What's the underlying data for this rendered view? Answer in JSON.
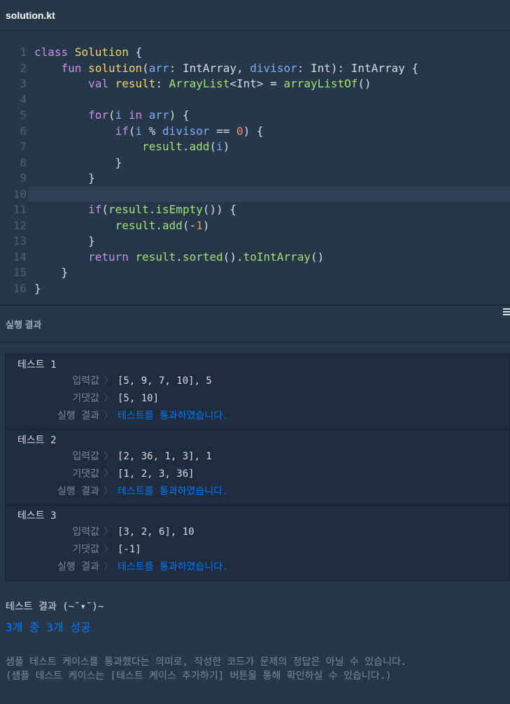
{
  "tab": {
    "title": "solution.kt"
  },
  "editor": {
    "active_line": 10,
    "line_numbers": [
      "1",
      "2",
      "3",
      "4",
      "5",
      "6",
      "7",
      "8",
      "9",
      "10",
      "11",
      "12",
      "13",
      "14",
      "15",
      "16"
    ]
  },
  "results": {
    "title": "실행 결과",
    "labels": {
      "input": "입력값",
      "expected": "기댓값",
      "result": "실행 결과",
      "sep": "〉"
    },
    "tests": [
      {
        "name": "테스트 1",
        "input": "[5, 9, 7, 10], 5",
        "expected": "[5, 10]",
        "result": "테스트를 통과하였습니다."
      },
      {
        "name": "테스트 2",
        "input": "[2, 36, 1, 3], 1",
        "expected": "[1, 2, 3, 36]",
        "result": "테스트를 통과하였습니다."
      },
      {
        "name": "테스트 3",
        "input": "[3, 2, 6], 10",
        "expected": "[-1]",
        "result": "테스트를 통과하였습니다."
      }
    ]
  },
  "summary": {
    "title": "테스트 결과 (~˘▾˘)~",
    "result": "3개 중 3개 성공",
    "note_line1": "샘플 테스트 케이스를 통과했다는 의미로, 작성한 코드가 문제의 정답은 아닐 수 있습니다.",
    "note_line2": "(샘플 테스트 케이스는 [테스트 케이스 추가하기] 버튼을 통해 확인하실 수 있습니다.)"
  },
  "colors": {
    "background": "#263747",
    "pass": "#0078ff",
    "panel": "#202b3d"
  }
}
